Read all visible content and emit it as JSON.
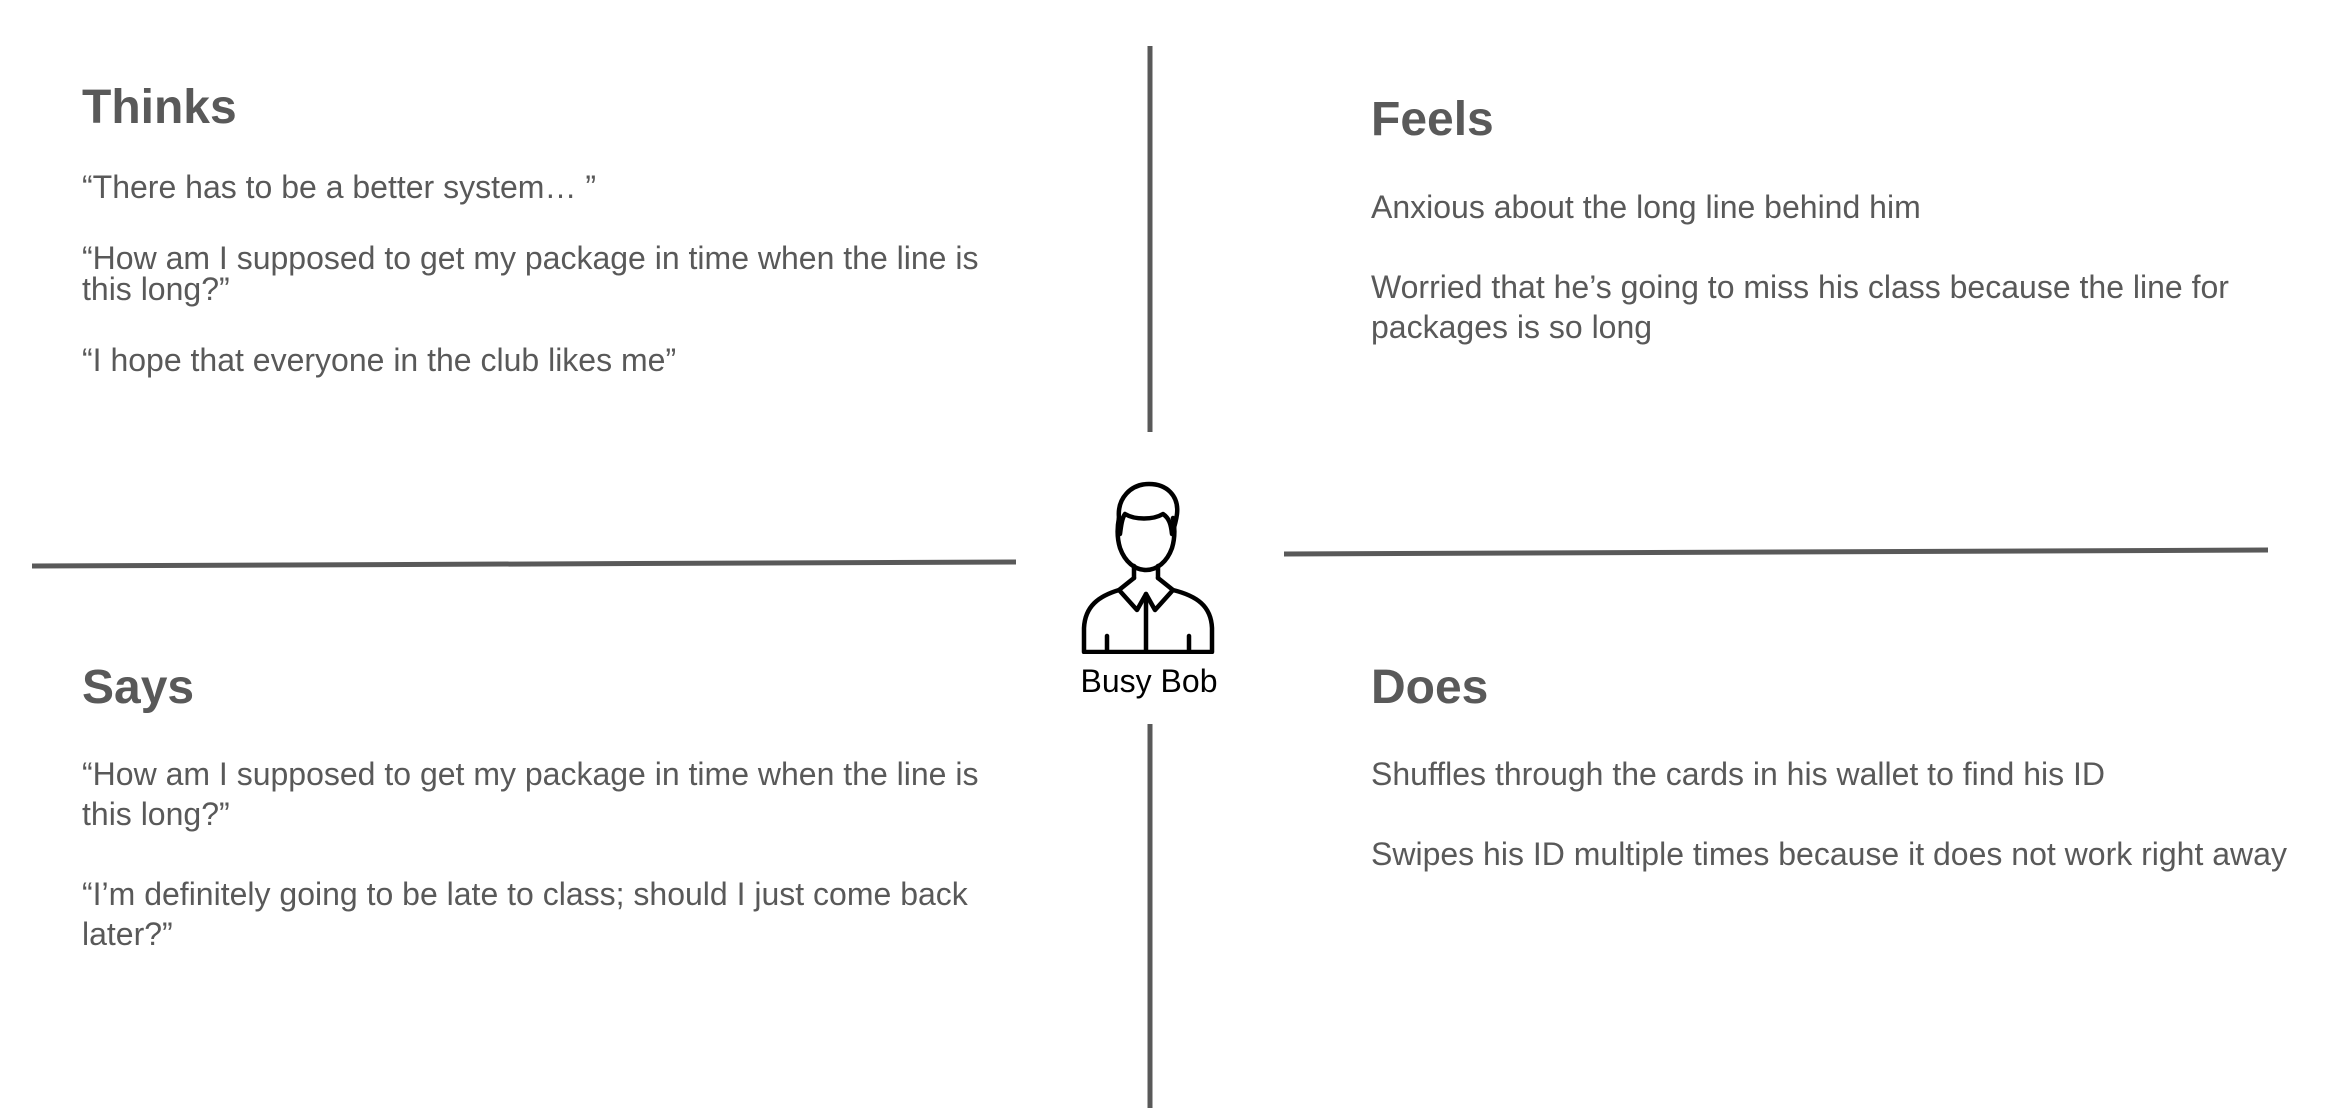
{
  "colors": {
    "text": "#595959",
    "divider": "#595959",
    "persona": "#000000",
    "background": "#ffffff"
  },
  "quadrants": {
    "thinks": {
      "title": "Thinks",
      "items": [
        "“There has to be a better system… ”",
        "“How am I supposed to get my package in time when the line is this long?”",
        "“I hope that everyone in the club likes me”"
      ]
    },
    "feels": {
      "title": "Feels",
      "items": [
        "Anxious about the long line behind him",
        "Worried that he’s going to miss his class because the line for packages is so long"
      ]
    },
    "says": {
      "title": "Says",
      "items": [
        "“How am I supposed to get my package in time when the line is this long?”",
        "“I’m definitely going to be late to class; should I just come back later?”"
      ]
    },
    "does": {
      "title": "Does",
      "items": [
        "Shuffles through the cards in his wallet to find his ID",
        "Swipes his ID multiple times because it does not work right away"
      ]
    }
  },
  "persona": {
    "name": "Busy Bob",
    "icon": "person-icon"
  }
}
